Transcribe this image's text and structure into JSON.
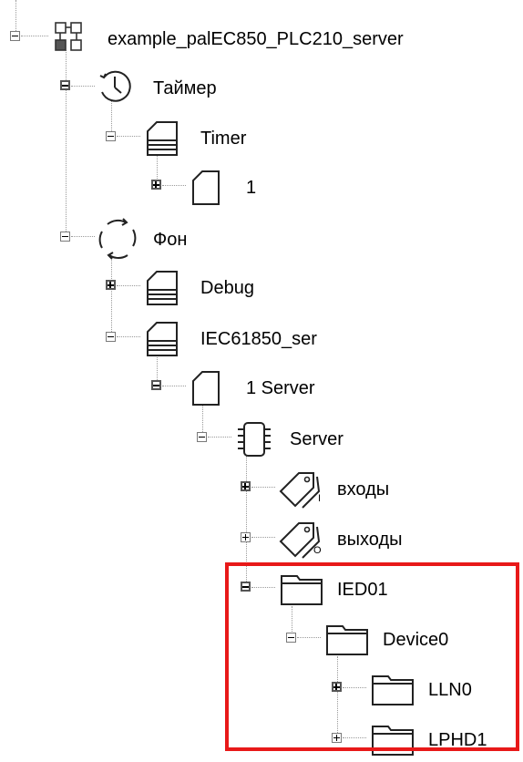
{
  "tree": {
    "root": {
      "label": "example_palEC850_PLC210_server",
      "icon": "network-icon"
    },
    "timer_task": {
      "label": "Таймер",
      "icon": "clock-icon"
    },
    "timer_program": {
      "label": "Timer",
      "icon": "program-stack-icon"
    },
    "timer_item": {
      "label": "1",
      "icon": "page-icon"
    },
    "background_task": {
      "label": "Фон",
      "icon": "cycle-icon"
    },
    "debug_program": {
      "label": "Debug",
      "icon": "program-stack-icon"
    },
    "iec_program": {
      "label": "IEC61850_ser",
      "icon": "program-stack-icon"
    },
    "server_page": {
      "label": "1 Server",
      "icon": "page-icon"
    },
    "server_module": {
      "label": "Server",
      "icon": "chip-icon"
    },
    "inputs": {
      "label": "входы",
      "icon": "tags-input-icon",
      "badge": "I"
    },
    "outputs": {
      "label": "выходы",
      "icon": "tags-output-icon",
      "badge": "O"
    },
    "ied01": {
      "label": "IED01",
      "icon": "folder-icon"
    },
    "device0": {
      "label": "Device0",
      "icon": "folder-icon"
    },
    "lln0": {
      "label": "LLN0",
      "icon": "folder-icon"
    },
    "lphd1": {
      "label": "LPHD1",
      "icon": "folder-icon"
    }
  },
  "highlight_color": "#e81919"
}
